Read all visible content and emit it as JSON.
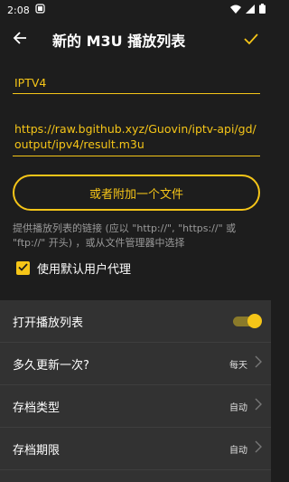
{
  "status": {
    "time": "2:08"
  },
  "header": {
    "title": "新的 M3U 播放列表"
  },
  "form": {
    "name_value": "IPTV4",
    "url_value": "https://raw.bgithub.xyz/Guovin/iptv-api/gd/output/ipv4/result.m3u",
    "file_button_label": "或者附加一个文件",
    "hint": "提供播放列表的链接 (应以 \"http://\", \"https://\" 或 \"ftp://\" 开头) ，或从文件管理器中选择",
    "user_agent_label": "使用默认用户代理",
    "user_agent_checked": true
  },
  "settings": [
    {
      "label": "打开播放列表",
      "type": "toggle",
      "on": true
    },
    {
      "label": "多久更新一次?",
      "type": "select",
      "value": "每天"
    },
    {
      "label": "存档类型",
      "type": "select",
      "value": "自动"
    },
    {
      "label": "存档期限",
      "type": "select",
      "value": "自动"
    }
  ],
  "colors": {
    "accent": "#f5c518",
    "background": "#1d1d1d",
    "panel": "#323232"
  }
}
